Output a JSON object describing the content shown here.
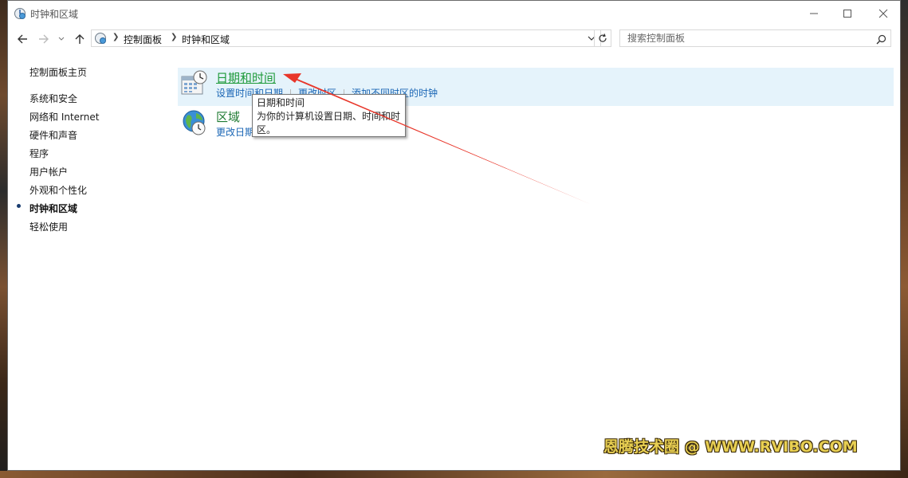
{
  "window": {
    "title": "时钟和区域",
    "controls": {
      "minimize": "minimize",
      "maximize": "maximize",
      "close": "close"
    }
  },
  "address": {
    "crumbs": [
      "控制面板",
      "时钟和区域"
    ],
    "search_placeholder": "搜索控制面板"
  },
  "sidebar": {
    "home": "控制面板主页",
    "items": [
      {
        "label": "系统和安全"
      },
      {
        "label": "网络和 Internet"
      },
      {
        "label": "硬件和声音"
      },
      {
        "label": "程序"
      },
      {
        "label": "用户帐户"
      },
      {
        "label": "外观和个性化"
      },
      {
        "label": "时钟和区域",
        "active": true
      },
      {
        "label": "轻松使用"
      }
    ]
  },
  "categories": [
    {
      "title": "日期和时间",
      "links": [
        "设置时间和日期",
        "更改时区",
        "添加不同时区的时钟"
      ],
      "icon": "calendar-clock-icon"
    },
    {
      "title": "区域",
      "links": [
        "更改日期"
      ],
      "icon": "globe-clock-icon"
    }
  ],
  "tooltip": {
    "title": "日期和时间",
    "line1": "为你的计算机设置日期、时间和时",
    "line2": "区。"
  },
  "watermark": "恩腾技术圈 @ WWW.RVIBO.COM",
  "colors": {
    "link": "#1a66b5",
    "category_title": "#1e7a32",
    "highlight": "#e5f3fb",
    "annotation_arrow": "#e8362a"
  }
}
